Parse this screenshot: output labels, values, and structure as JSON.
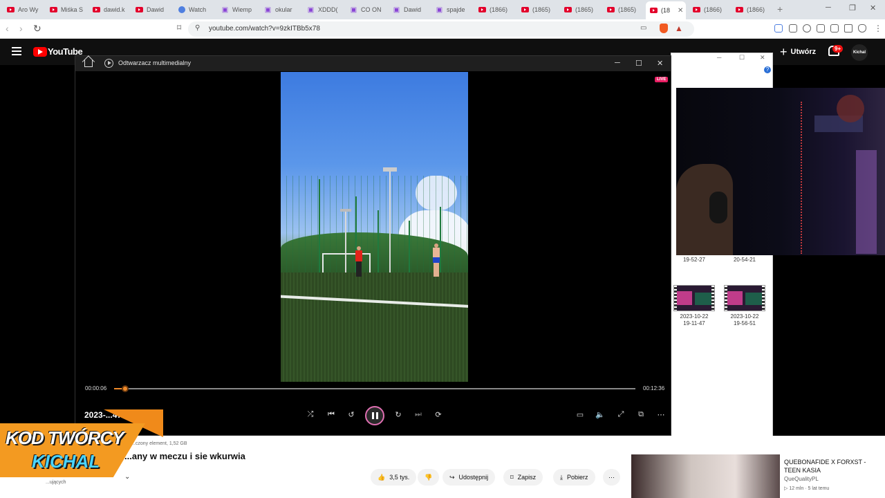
{
  "browser": {
    "tabs": [
      {
        "label": "Aro Wy",
        "icon": "youtube"
      },
      {
        "label": "Miśka S",
        "icon": "youtube"
      },
      {
        "label": "dawid.k",
        "icon": "youtube"
      },
      {
        "label": "Dawid",
        "icon": "youtube"
      },
      {
        "label": "Watch",
        "icon": "watch"
      },
      {
        "label": "Wiemp",
        "icon": "twitch"
      },
      {
        "label": "okular",
        "icon": "twitch"
      },
      {
        "label": "XDDD(",
        "icon": "twitch"
      },
      {
        "label": "CO ON",
        "icon": "twitch"
      },
      {
        "label": "Dawid",
        "icon": "twitch"
      },
      {
        "label": "spajde",
        "icon": "twitch"
      },
      {
        "label": "(1866)",
        "icon": "youtube"
      },
      {
        "label": "(1865)",
        "icon": "youtube"
      },
      {
        "label": "(1865)",
        "icon": "youtube"
      },
      {
        "label": "(1865)",
        "icon": "youtube"
      },
      {
        "label": "(18",
        "icon": "youtube",
        "active": true
      },
      {
        "label": "(1866)",
        "icon": "youtube"
      },
      {
        "label": "(1866)",
        "icon": "youtube"
      }
    ],
    "url": "youtube.com/watch?v=9zkITBb5x78"
  },
  "youtube": {
    "logo_text": "YouTube",
    "create_label": "Utwórz",
    "notifications_badge": "9+",
    "avatar_text": "Kichal"
  },
  "explorer": {
    "files": [
      {
        "line1": "",
        "line2": "19-52-27"
      },
      {
        "line1": "",
        "line2": "20-54-21"
      },
      {
        "line1": "2023-10-22",
        "line2": "19-11-47"
      },
      {
        "line1": "2023-10-22",
        "line2": "19-56-51"
      }
    ]
  },
  "player": {
    "title": "Odtwarzacz multimedialny",
    "live_badge": "LIVE",
    "current_time": "00:00:06",
    "total_time": "00:12:36",
    "progress": 0.008,
    "file_name_partial": "2023-...47"
  },
  "page": {
    "path_info": "...czony element, 1,52 GB",
    "video_title": "...any w meczu i sie wkurwia",
    "channel_partial": "...ujących",
    "likes": "3,5 tys.",
    "share_label": "Udostępnij",
    "save_label": "Zapisz",
    "download_label": "Pobierz",
    "recommended": {
      "title": "QUEBONAFIDE X FORXST - TEEN KASIA",
      "channel": "QueQualityPL",
      "meta": "▷ 12 mln · 5 lat temu"
    }
  },
  "banner": {
    "line1": "KOD TWÓRCY",
    "line2": "KICHAL"
  },
  "colors": {
    "seek_accent": "#f08a2a",
    "play_ring": "#e06fb2",
    "live": "#e91e63",
    "banner_orange": "#f39a21",
    "banner_blue": "#4ad4ff"
  }
}
